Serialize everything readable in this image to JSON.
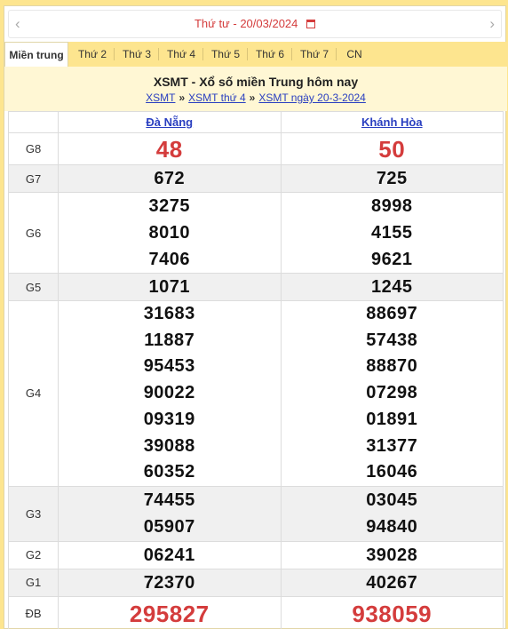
{
  "datebar": {
    "weekday": "Thứ tư -",
    "date": "20/03/2024",
    "calendar_icon": "calendar-icon",
    "prev_icon": "chevron-left-icon",
    "next_icon": "chevron-right-icon"
  },
  "tabs": [
    "Miền trung",
    "Thứ 2",
    "Thứ 3",
    "Thứ 4",
    "Thứ 5",
    "Thứ 6",
    "Thứ 7",
    "CN"
  ],
  "heading": {
    "title": "XSMT - Xổ số miền Trung hôm nay",
    "crumb1": "XSMT",
    "crumb2": "XSMT thứ 4",
    "crumb3": "XSMT ngày 20-3-2024",
    "sep": "»"
  },
  "table": {
    "provinces": [
      "Đà Nẵng",
      "Khánh Hòa"
    ],
    "rows": [
      {
        "label": "G8",
        "a": [
          "48"
        ],
        "b": [
          "50"
        ]
      },
      {
        "label": "G7",
        "a": [
          "672"
        ],
        "b": [
          "725"
        ]
      },
      {
        "label": "G6",
        "a": [
          "3275",
          "8010",
          "7406"
        ],
        "b": [
          "8998",
          "4155",
          "9621"
        ]
      },
      {
        "label": "G5",
        "a": [
          "1071"
        ],
        "b": [
          "1245"
        ]
      },
      {
        "label": "G4",
        "a": [
          "31683",
          "11887",
          "95453",
          "90022",
          "09319",
          "39088",
          "60352"
        ],
        "b": [
          "88697",
          "57438",
          "88870",
          "07298",
          "01891",
          "31377",
          "16046"
        ]
      },
      {
        "label": "G3",
        "a": [
          "74455",
          "05907"
        ],
        "b": [
          "03045",
          "94840"
        ]
      },
      {
        "label": "G2",
        "a": [
          "06241"
        ],
        "b": [
          "39028"
        ]
      },
      {
        "label": "G1",
        "a": [
          "72370"
        ],
        "b": [
          "40267"
        ]
      },
      {
        "label": "ĐB",
        "a": [
          "295827"
        ],
        "b": [
          "938059"
        ]
      }
    ]
  },
  "colors": {
    "accent_red": "#d43c3c",
    "link_blue": "#2a3fc0",
    "tab_bg": "#fde58f"
  }
}
